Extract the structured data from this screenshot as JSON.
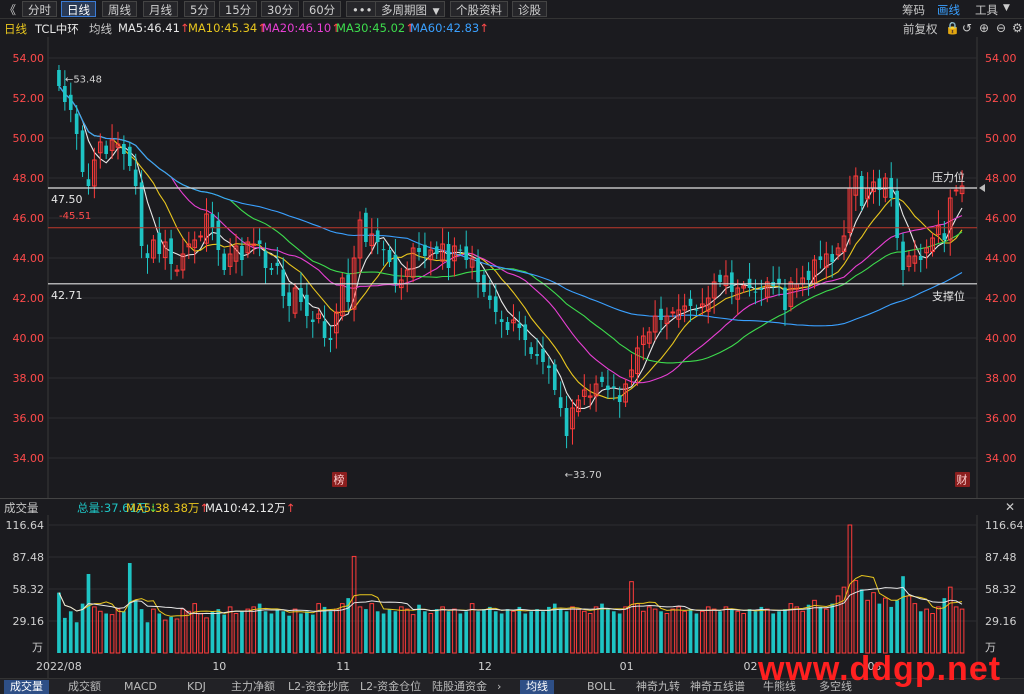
{
  "toolbar": {
    "back": "《",
    "periods": [
      "分时",
      "日线",
      "周线",
      "月线",
      "5分",
      "15分",
      "30分",
      "60分"
    ],
    "active_period": "日线",
    "more": "•••",
    "multi_period": "多周期图",
    "profile": "个股资料",
    "diagnose": "诊股",
    "right_items": [
      "筹码",
      "画线",
      "工具"
    ]
  },
  "info": {
    "period": "日线",
    "stock": "TCL中环",
    "ma_label": "均线",
    "ma": [
      {
        "label": "MA5:46.41",
        "arrow": "↑",
        "color": "#e8e8e8"
      },
      {
        "label": "MA10:45.34",
        "arrow": "↑",
        "color": "#e8c61e"
      },
      {
        "label": "MA20:46.10",
        "arrow": "↑",
        "color": "#e83fd4"
      },
      {
        "label": "MA30:45.02",
        "arrow": "↑",
        "color": "#3ddc4d"
      },
      {
        "label": "MA60:42.83",
        "arrow": "↑",
        "color": "#3aa0ff"
      }
    ],
    "adjust": "前复权"
  },
  "volume_info": {
    "title": "成交量",
    "total": "总量:37.61万",
    "total_arrow": "↓",
    "ma5": "MA5:38.38万",
    "ma5_arrow": "↑",
    "ma10": "MA10:42.12万",
    "ma10_arrow": "↑"
  },
  "bottom_tabs": [
    "成交量",
    "成交额",
    "MACD",
    "KDJ",
    "主力净额",
    "L2-资金抄底",
    "L2-资金仓位",
    "陆股通资金"
  ],
  "bottom_tabs2": [
    "均线",
    "BOLL",
    "神奇九转",
    "神奇五线谱",
    "牛熊线",
    "多空线"
  ],
  "watermark": "www.ddgp.net",
  "chart_data": {
    "type": "candlestick",
    "price_axis": {
      "ticks": [
        "54.00",
        "52.00",
        "50.00",
        "48.00",
        "46.00",
        "44.00",
        "42.00",
        "40.00",
        "38.00",
        "36.00",
        "34.00"
      ],
      "ylim": [
        33.2,
        54.8
      ]
    },
    "volume_axis": {
      "ticks": [
        "116.64",
        "87.48",
        "58.32",
        "29.16"
      ],
      "unit": "万",
      "ylim": [
        0,
        116.64
      ]
    },
    "x_ticks": [
      "2022/08",
      "10",
      "11",
      "12",
      "01",
      "02",
      "03"
    ],
    "annotations": {
      "high": "53.48",
      "low": "33.70",
      "ref_value": "45.51",
      "resistance_value": "47.50",
      "resistance_label": "压力位",
      "support_value": "42.71",
      "support_label": "支撑位",
      "marker_left": "榜",
      "marker_right": "财"
    },
    "closes": [
      52.6,
      51.8,
      51.4,
      50.2,
      48.3,
      47.6,
      48.9,
      49.8,
      49.2,
      49.9,
      49.7,
      49.2,
      48.6,
      47.6,
      44.6,
      44.0,
      44.9,
      44.2,
      44.8,
      43.7,
      43.4,
      44.2,
      44.7,
      44.9,
      45.1,
      46.2,
      45.5,
      44.4,
      43.4,
      44.2,
      44.6,
      43.9,
      44.8,
      44.7,
      44.7,
      43.5,
      43.4,
      43.6,
      42.1,
      41.6,
      42.5,
      41.8,
      41.1,
      40.8,
      41.2,
      40.0,
      39.9,
      41.3,
      43.0,
      41.8,
      44.0,
      45.9,
      44.8,
      45.2,
      44.8,
      44.4,
      43.8,
      42.7,
      42.9,
      43.4,
      44.5,
      44.3,
      44.1,
      44.4,
      44.2,
      44.7,
      43.5,
      44.6,
      44.4,
      43.9,
      44.0,
      42.8,
      42.3,
      41.9,
      41.3,
      40.8,
      40.4,
      40.9,
      40.5,
      39.9,
      39.2,
      39.1,
      38.8,
      38.5,
      37.4,
      36.5,
      35.1,
      36.5,
      36.9,
      37.4,
      37.1,
      37.7,
      37.8,
      37.4,
      37.5,
      36.8,
      37.7,
      38.4,
      39.5,
      40.1,
      40.3,
      41.1,
      40.9,
      41.1,
      41.3,
      41.4,
      41.6,
      41.6,
      41.4,
      41.7,
      42.0,
      42.8,
      42.8,
      43.1,
      42.3,
      42.5,
      42.6,
      42.5,
      42.3,
      42.4,
      42.8,
      42.6,
      42.7,
      41.4,
      42.8,
      42.7,
      43.0,
      42.9,
      43.9,
      43.9,
      44.2,
      43.8,
      44.5,
      45.1,
      47.5,
      48.1,
      46.6,
      47.5,
      47.8,
      47.4,
      48.0,
      47.0,
      45.0,
      43.4,
      44.1,
      44.1,
      43.9,
      44.5,
      45.0,
      45.6,
      44.9,
      47.0,
      47.4,
      47.6
    ],
    "volumes": [
      55,
      32,
      38,
      28,
      45,
      72,
      42,
      38,
      36,
      35,
      40,
      38,
      82,
      48,
      40,
      28,
      40,
      36,
      30,
      33,
      31,
      40,
      38,
      45,
      36,
      32,
      38,
      40,
      35,
      42,
      36,
      38,
      40,
      42,
      45,
      38,
      36,
      40,
      38,
      34,
      40,
      36,
      38,
      35,
      45,
      42,
      38,
      40,
      45,
      50,
      88,
      42,
      40,
      45,
      38,
      36,
      40,
      38,
      42,
      40,
      35,
      44,
      38,
      36,
      40,
      42,
      38,
      40,
      36,
      38,
      45,
      38,
      40,
      42,
      38,
      36,
      40,
      38,
      42,
      36,
      38,
      40,
      38,
      42,
      45,
      40,
      38,
      42,
      40,
      38,
      36,
      42,
      45,
      40,
      38,
      36,
      42,
      65,
      45,
      38,
      42,
      40,
      38,
      36,
      40,
      42,
      38,
      40,
      36,
      38,
      42,
      40,
      38,
      42,
      40,
      38,
      36,
      40,
      38,
      42,
      40,
      36,
      38,
      40,
      45,
      42,
      38,
      44,
      48,
      42,
      40,
      45,
      52,
      60,
      117,
      66,
      58,
      48,
      55,
      45,
      50,
      42,
      48,
      70,
      52,
      45,
      38,
      40,
      36,
      42,
      50,
      60,
      42,
      40
    ]
  }
}
